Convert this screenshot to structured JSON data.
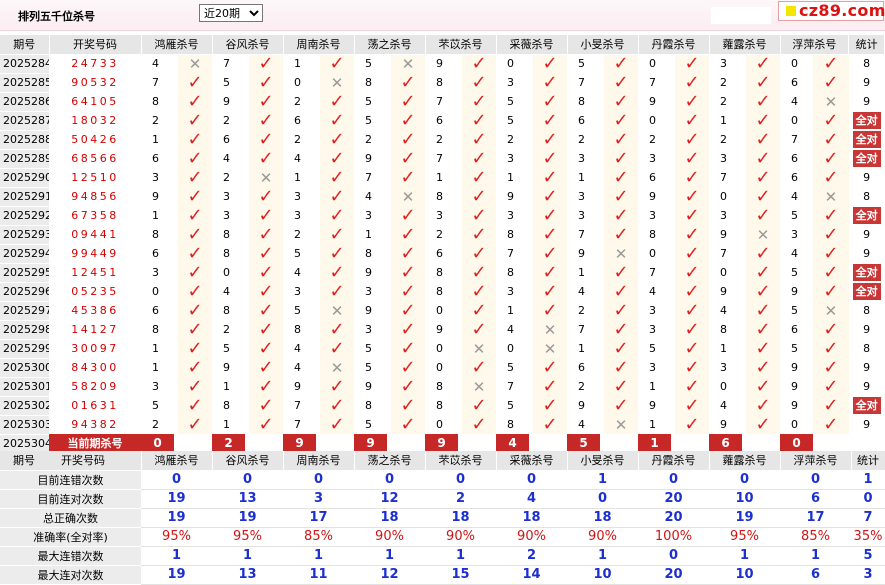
{
  "header": {
    "title": "排列五千位杀号",
    "period_select": "近20期",
    "logo_text": "cz89.com"
  },
  "columns": [
    "期号",
    "开奖号码",
    "鸿雁杀号",
    "谷风杀号",
    "周南杀号",
    "荡之杀号",
    "芣苡杀号",
    "采薇杀号",
    "小旻杀号",
    "丹霞杀号",
    "蕹露杀号",
    "浮萍杀号",
    "统计"
  ],
  "rows": [
    {
      "issue": "2025284",
      "draw": "24733",
      "k": [
        [
          4,
          0
        ],
        [
          7,
          1
        ],
        [
          1,
          1
        ],
        [
          5,
          0
        ],
        [
          9,
          1
        ],
        [
          0,
          1
        ],
        [
          5,
          1
        ],
        [
          0,
          1
        ],
        [
          3,
          1
        ],
        [
          0,
          1
        ]
      ],
      "stat": "8"
    },
    {
      "issue": "2025285",
      "draw": "90532",
      "k": [
        [
          7,
          1
        ],
        [
          5,
          1
        ],
        [
          0,
          0
        ],
        [
          8,
          1
        ],
        [
          8,
          1
        ],
        [
          3,
          1
        ],
        [
          7,
          1
        ],
        [
          7,
          1
        ],
        [
          2,
          1
        ],
        [
          6,
          1
        ]
      ],
      "stat": "9"
    },
    {
      "issue": "2025286",
      "draw": "64105",
      "k": [
        [
          8,
          1
        ],
        [
          9,
          1
        ],
        [
          2,
          1
        ],
        [
          5,
          1
        ],
        [
          7,
          1
        ],
        [
          5,
          1
        ],
        [
          8,
          1
        ],
        [
          9,
          1
        ],
        [
          2,
          1
        ],
        [
          4,
          0
        ]
      ],
      "stat": "9"
    },
    {
      "issue": "2025287",
      "draw": "18032",
      "k": [
        [
          2,
          1
        ],
        [
          2,
          1
        ],
        [
          6,
          1
        ],
        [
          5,
          1
        ],
        [
          6,
          1
        ],
        [
          5,
          1
        ],
        [
          6,
          1
        ],
        [
          0,
          1
        ],
        [
          1,
          1
        ],
        [
          0,
          1
        ]
      ],
      "stat": "全对"
    },
    {
      "issue": "2025288",
      "draw": "50426",
      "k": [
        [
          1,
          1
        ],
        [
          6,
          1
        ],
        [
          2,
          1
        ],
        [
          2,
          1
        ],
        [
          2,
          1
        ],
        [
          2,
          1
        ],
        [
          2,
          1
        ],
        [
          2,
          1
        ],
        [
          2,
          1
        ],
        [
          7,
          1
        ]
      ],
      "stat": "全对"
    },
    {
      "issue": "2025289",
      "draw": "68566",
      "k": [
        [
          6,
          1
        ],
        [
          4,
          1
        ],
        [
          4,
          1
        ],
        [
          9,
          1
        ],
        [
          7,
          1
        ],
        [
          3,
          1
        ],
        [
          3,
          1
        ],
        [
          3,
          1
        ],
        [
          3,
          1
        ],
        [
          6,
          1
        ]
      ],
      "stat": "全对"
    },
    {
      "issue": "2025290",
      "draw": "12510",
      "k": [
        [
          3,
          1
        ],
        [
          2,
          0
        ],
        [
          1,
          1
        ],
        [
          7,
          1
        ],
        [
          1,
          1
        ],
        [
          1,
          1
        ],
        [
          1,
          1
        ],
        [
          6,
          1
        ],
        [
          7,
          1
        ],
        [
          6,
          1
        ]
      ],
      "stat": "9"
    },
    {
      "issue": "2025291",
      "draw": "94856",
      "k": [
        [
          9,
          1
        ],
        [
          3,
          1
        ],
        [
          3,
          1
        ],
        [
          4,
          0
        ],
        [
          8,
          1
        ],
        [
          9,
          1
        ],
        [
          3,
          1
        ],
        [
          9,
          1
        ],
        [
          0,
          1
        ],
        [
          4,
          0
        ]
      ],
      "stat": "8"
    },
    {
      "issue": "2025292",
      "draw": "67358",
      "k": [
        [
          1,
          1
        ],
        [
          3,
          1
        ],
        [
          3,
          1
        ],
        [
          3,
          1
        ],
        [
          3,
          1
        ],
        [
          3,
          1
        ],
        [
          3,
          1
        ],
        [
          3,
          1
        ],
        [
          3,
          1
        ],
        [
          5,
          1
        ]
      ],
      "stat": "全对"
    },
    {
      "issue": "2025293",
      "draw": "09441",
      "k": [
        [
          8,
          1
        ],
        [
          8,
          1
        ],
        [
          2,
          1
        ],
        [
          1,
          1
        ],
        [
          2,
          1
        ],
        [
          8,
          1
        ],
        [
          7,
          1
        ],
        [
          8,
          1
        ],
        [
          9,
          0
        ],
        [
          3,
          1
        ]
      ],
      "stat": "9"
    },
    {
      "issue": "2025294",
      "draw": "99449",
      "k": [
        [
          6,
          1
        ],
        [
          8,
          1
        ],
        [
          5,
          1
        ],
        [
          8,
          1
        ],
        [
          6,
          1
        ],
        [
          7,
          1
        ],
        [
          9,
          0
        ],
        [
          0,
          1
        ],
        [
          7,
          1
        ],
        [
          4,
          1
        ]
      ],
      "stat": "9"
    },
    {
      "issue": "2025295",
      "draw": "12451",
      "k": [
        [
          3,
          1
        ],
        [
          0,
          1
        ],
        [
          4,
          1
        ],
        [
          9,
          1
        ],
        [
          8,
          1
        ],
        [
          8,
          1
        ],
        [
          1,
          1
        ],
        [
          7,
          1
        ],
        [
          0,
          1
        ],
        [
          5,
          1
        ]
      ],
      "stat": "全对"
    },
    {
      "issue": "2025296",
      "draw": "05235",
      "k": [
        [
          0,
          1
        ],
        [
          4,
          1
        ],
        [
          3,
          1
        ],
        [
          3,
          1
        ],
        [
          8,
          1
        ],
        [
          3,
          1
        ],
        [
          4,
          1
        ],
        [
          4,
          1
        ],
        [
          9,
          1
        ],
        [
          9,
          1
        ]
      ],
      "stat": "全对"
    },
    {
      "issue": "2025297",
      "draw": "45386",
      "k": [
        [
          6,
          1
        ],
        [
          8,
          1
        ],
        [
          5,
          0
        ],
        [
          9,
          1
        ],
        [
          0,
          1
        ],
        [
          1,
          1
        ],
        [
          2,
          1
        ],
        [
          3,
          1
        ],
        [
          4,
          1
        ],
        [
          5,
          0
        ]
      ],
      "stat": "8"
    },
    {
      "issue": "2025298",
      "draw": "14127",
      "k": [
        [
          8,
          1
        ],
        [
          2,
          1
        ],
        [
          8,
          1
        ],
        [
          3,
          1
        ],
        [
          9,
          1
        ],
        [
          4,
          0
        ],
        [
          7,
          1
        ],
        [
          3,
          1
        ],
        [
          8,
          1
        ],
        [
          6,
          1
        ]
      ],
      "stat": "9"
    },
    {
      "issue": "2025299",
      "draw": "30097",
      "k": [
        [
          1,
          1
        ],
        [
          5,
          1
        ],
        [
          4,
          1
        ],
        [
          5,
          1
        ],
        [
          0,
          0
        ],
        [
          0,
          0
        ],
        [
          1,
          1
        ],
        [
          5,
          1
        ],
        [
          1,
          1
        ],
        [
          5,
          1
        ]
      ],
      "stat": "8"
    },
    {
      "issue": "2025300",
      "draw": "84300",
      "k": [
        [
          1,
          1
        ],
        [
          9,
          1
        ],
        [
          4,
          0
        ],
        [
          5,
          1
        ],
        [
          0,
          1
        ],
        [
          5,
          1
        ],
        [
          6,
          1
        ],
        [
          3,
          1
        ],
        [
          3,
          1
        ],
        [
          9,
          1
        ]
      ],
      "stat": "9"
    },
    {
      "issue": "2025301",
      "draw": "58209",
      "k": [
        [
          3,
          1
        ],
        [
          1,
          1
        ],
        [
          9,
          1
        ],
        [
          9,
          1
        ],
        [
          8,
          0
        ],
        [
          7,
          1
        ],
        [
          2,
          1
        ],
        [
          1,
          1
        ],
        [
          0,
          1
        ],
        [
          9,
          1
        ]
      ],
      "stat": "9"
    },
    {
      "issue": "2025302",
      "draw": "01631",
      "k": [
        [
          5,
          1
        ],
        [
          8,
          1
        ],
        [
          7,
          1
        ],
        [
          8,
          1
        ],
        [
          8,
          1
        ],
        [
          5,
          1
        ],
        [
          9,
          1
        ],
        [
          9,
          1
        ],
        [
          4,
          1
        ],
        [
          9,
          1
        ]
      ],
      "stat": "全对"
    },
    {
      "issue": "2025303",
      "draw": "94382",
      "k": [
        [
          2,
          1
        ],
        [
          1,
          1
        ],
        [
          7,
          1
        ],
        [
          5,
          1
        ],
        [
          0,
          1
        ],
        [
          8,
          1
        ],
        [
          4,
          0
        ],
        [
          1,
          1
        ],
        [
          9,
          1
        ],
        [
          0,
          1
        ]
      ],
      "stat": "9"
    }
  ],
  "current": {
    "issue": "2025304",
    "label": "当前期杀号",
    "values": [
      "0",
      "2",
      "9",
      "9",
      "9",
      "4",
      "5",
      "1",
      "6",
      "0"
    ]
  },
  "stats": [
    {
      "label": "目前连错次数",
      "values": [
        "0",
        "0",
        "0",
        "0",
        "0",
        "0",
        "1",
        "0",
        "0",
        "0",
        "1"
      ]
    },
    {
      "label": "目前连对次数",
      "values": [
        "19",
        "13",
        "3",
        "12",
        "2",
        "4",
        "0",
        "20",
        "10",
        "6",
        "0"
      ]
    },
    {
      "label": "总正确次数",
      "values": [
        "19",
        "19",
        "17",
        "18",
        "18",
        "18",
        "18",
        "20",
        "19",
        "17",
        "7"
      ]
    },
    {
      "label": "准确率(全对率)",
      "values": [
        "95%",
        "95%",
        "85%",
        "90%",
        "90%",
        "90%",
        "90%",
        "100%",
        "95%",
        "85%",
        "35%"
      ],
      "pct": true
    },
    {
      "label": "最大连错次数",
      "values": [
        "1",
        "1",
        "1",
        "1",
        "1",
        "2",
        "1",
        "0",
        "1",
        "1",
        "5"
      ]
    },
    {
      "label": "最大连对次数",
      "values": [
        "19",
        "13",
        "11",
        "12",
        "15",
        "14",
        "10",
        "20",
        "10",
        "6",
        "3"
      ]
    }
  ]
}
